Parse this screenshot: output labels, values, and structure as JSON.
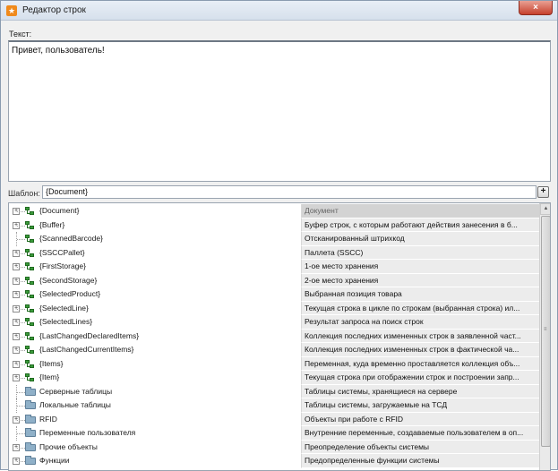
{
  "window": {
    "title": "Редактор строк",
    "close_symbol": "×",
    "app_icon": "star-icon"
  },
  "editor": {
    "text_label": "Текст:",
    "text_value": "Привет, пользователь!",
    "template_label": "Шаблон:",
    "template_value": "{Document}",
    "template_button": "+"
  },
  "tree": {
    "rows": [
      {
        "label": "{Document}",
        "description": "Документ",
        "expandable": true,
        "icon": "node",
        "selected": true
      },
      {
        "label": "{Buffer}",
        "description": "Буфер строк, с которым работают действия занесения в б...",
        "expandable": true,
        "icon": "node"
      },
      {
        "label": "{ScannedBarcode}",
        "description": "Отсканированный штрихкод",
        "expandable": false,
        "icon": "node"
      },
      {
        "label": "{SSCCPallet}",
        "description": "Паллета (SSCC)",
        "expandable": true,
        "icon": "node"
      },
      {
        "label": "{FirstStorage}",
        "description": "1-ое место хранения",
        "expandable": true,
        "icon": "node"
      },
      {
        "label": "{SecondStorage}",
        "description": "2-ое место хранения",
        "expandable": true,
        "icon": "node"
      },
      {
        "label": "{SelectedProduct}",
        "description": "Выбранная позиция товара",
        "expandable": true,
        "icon": "node"
      },
      {
        "label": "{SelectedLine}",
        "description": "Текущая строка в цикле по строкам (выбранная строка) ил...",
        "expandable": true,
        "icon": "node"
      },
      {
        "label": "{SelectedLines}",
        "description": "Результат запроса на поиск строк",
        "expandable": true,
        "icon": "node"
      },
      {
        "label": "{LastChangedDeclaredItems}",
        "description": "Коллекция последних измененных строк в заявленной част...",
        "expandable": true,
        "icon": "node"
      },
      {
        "label": "{LastChangedCurrentItems}",
        "description": "Коллекция последних измененных строк в фактической ча...",
        "expandable": true,
        "icon": "node"
      },
      {
        "label": "{Items}",
        "description": "Переменная, куда временно проставляется коллекция объ...",
        "expandable": true,
        "icon": "node"
      },
      {
        "label": "{Item}",
        "description": "Текущая строка при отображении строк и построении запр...",
        "expandable": true,
        "icon": "node"
      },
      {
        "label": "Серверные таблицы",
        "description": "Таблицы системы, хранящиеся на сервере",
        "expandable": false,
        "icon": "folder"
      },
      {
        "label": "Локальные таблицы",
        "description": "Таблицы системы, загружаемые на ТСД",
        "expandable": false,
        "icon": "folder"
      },
      {
        "label": "RFID",
        "description": "Объекты при работе с RFID",
        "expandable": true,
        "icon": "folder"
      },
      {
        "label": "Переменные пользователя",
        "description": "Внутренние переменные, создаваемые пользователем в оп...",
        "expandable": false,
        "icon": "folder"
      },
      {
        "label": "Прочие объекты",
        "description": "Преопределение объекты системы",
        "expandable": true,
        "icon": "folder"
      },
      {
        "label": "Функции",
        "description": "Предопределенные функции системы",
        "expandable": true,
        "icon": "folder"
      }
    ]
  }
}
